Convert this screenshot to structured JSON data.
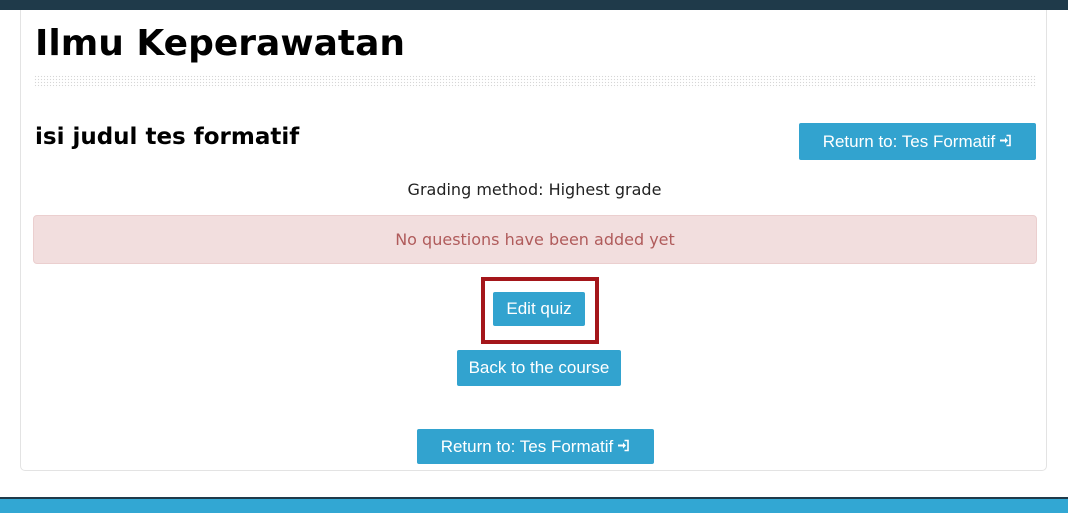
{
  "course": {
    "title": "Ilmu Keperawatan"
  },
  "quiz": {
    "title": "isi judul tes formatif",
    "grading_method": "Grading method: Highest grade",
    "alert": "No questions have been added yet"
  },
  "buttons": {
    "return_label": "Return to: Tes Formatif",
    "edit_quiz": "Edit quiz",
    "back_to_course": "Back to the course"
  },
  "icons": {
    "return_icon": "sign-in-icon"
  },
  "colors": {
    "button_bg": "#32a3cf",
    "alert_bg": "#f2dede",
    "alert_text": "#b05b5b",
    "highlight": "#a4161a",
    "top_bar": "#1f3a4a"
  }
}
